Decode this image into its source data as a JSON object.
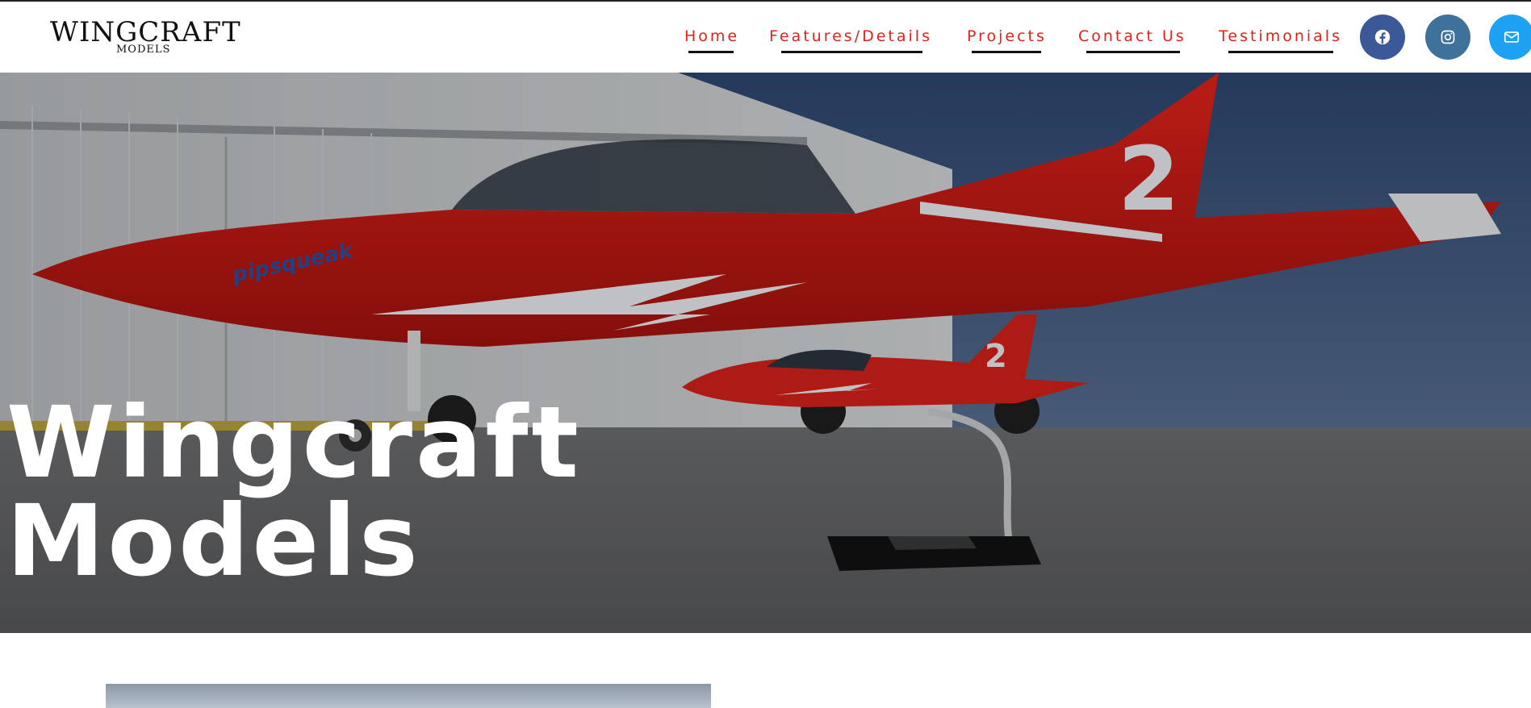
{
  "header": {
    "logo_main": "WINGCRAFT",
    "logo_sub": "MODELS"
  },
  "nav": {
    "items": [
      {
        "label": "Home"
      },
      {
        "label": "Features/Details"
      },
      {
        "label": "Projects"
      },
      {
        "label": "Contact Us"
      },
      {
        "label": "Testimonials"
      }
    ],
    "link_color": "#e32219"
  },
  "social": [
    {
      "icon": "facebook-icon",
      "color": "#3b5998"
    },
    {
      "icon": "instagram-icon",
      "color": "#3f729b"
    },
    {
      "icon": "email-icon",
      "color": "#1da1f2"
    }
  ],
  "hero": {
    "title_line1": "Wingcraft",
    "title_line2": "Models",
    "aircraft_number": "2",
    "aircraft_name": "pipsqueak"
  }
}
